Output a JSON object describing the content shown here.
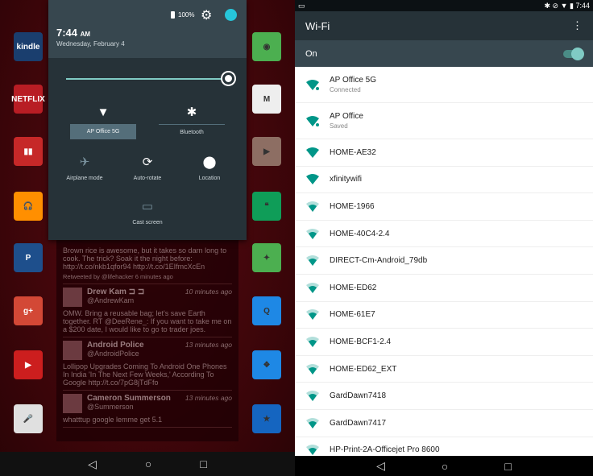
{
  "launcher": {
    "left_icons": [
      {
        "name": "kindle",
        "label": "kindle",
        "color": "#1a3e6e"
      },
      {
        "name": "netflix",
        "label": "NETFLIX",
        "color": "#b81d24"
      },
      {
        "name": "video",
        "label": "▮▮",
        "color": "#c62828"
      },
      {
        "name": "music",
        "label": "🎧",
        "color": "#ff8f00"
      },
      {
        "name": "pandora",
        "label": "P",
        "color": "#1e4f8c"
      },
      {
        "name": "google-plus",
        "label": "g+",
        "color": "#d34836"
      },
      {
        "name": "youtube",
        "label": "▶",
        "color": "#cc1e1e"
      },
      {
        "name": "voice",
        "label": "🎤",
        "color": "#e0e0e0"
      }
    ],
    "right_icons": [
      {
        "name": "chrome",
        "label": "◉",
        "color": "#4caf50"
      },
      {
        "name": "gmail",
        "label": "M",
        "color": "#eeeeee"
      },
      {
        "name": "play-store",
        "label": "▶",
        "color": "#8d6e63"
      },
      {
        "name": "hangouts",
        "label": "❝",
        "color": "#0f9d58"
      },
      {
        "name": "maps",
        "label": "✦",
        "color": "#4caf50"
      },
      {
        "name": "search",
        "label": "Q",
        "color": "#1e88e5"
      },
      {
        "name": "dropbox",
        "label": "❖",
        "color": "#1e88e5"
      },
      {
        "name": "app",
        "label": "★",
        "color": "#1565c0"
      }
    ]
  },
  "shade": {
    "battery": "100%",
    "time": "7:44",
    "ampm": "AM",
    "date": "Wednesday, February 4",
    "brightness": 1.0,
    "tiles": {
      "wifi": "AP Office 5G",
      "bluetooth": "Bluetooth",
      "airplane": "Airplane mode",
      "rotate": "Auto-rotate",
      "location": "Location",
      "cast": "Cast screen"
    }
  },
  "tweets": {
    "first_text": "Brown rice is awesome, but it takes so darn long to cook. The trick? Soak it the night before: http://t.co/nkb1qfor94 http://t.co/1EIfmcXcEn",
    "first_meta": "Retweeted by @lifehacker 6 minutes ago",
    "items": [
      {
        "name": "Drew Kam ⊐ ⊐",
        "handle": "@AndrewKam",
        "time": "10 minutes ago",
        "text": "OMW. Bring a reusable bag; let's save Earth together. RT @DeeRene_: If you want to take me on a $200 date, I would like to go to trader joes."
      },
      {
        "name": "Android Police",
        "handle": "@AndroidPolice",
        "time": "13 minutes ago",
        "text": "Lollipop Upgrades Coming To Android One Phones In India 'In The Next Few Weeks,' According To Google http://t.co/7pG8jTdFfo"
      },
      {
        "name": "Cameron Summerson",
        "handle": "@Summerson",
        "time": "13 minutes ago",
        "text": "whatttup google lemme get 5.1"
      }
    ]
  },
  "wifi": {
    "status_time": "7:44",
    "title": "Wi-Fi",
    "toggle_label": "On",
    "toggle_on": true,
    "accent": "#009688",
    "networks": [
      {
        "name": "AP Office 5G",
        "status": "Connected",
        "strength": 4
      },
      {
        "name": "AP Office",
        "status": "Saved",
        "strength": 4
      },
      {
        "name": "HOME-AE32",
        "strength": 4
      },
      {
        "name": "xfinitywifi",
        "strength": 4
      },
      {
        "name": "HOME-1966",
        "strength": 3
      },
      {
        "name": "HOME-40C4-2.4",
        "strength": 3
      },
      {
        "name": "DIRECT-Cm-Android_79db",
        "strength": 3
      },
      {
        "name": "HOME-ED62",
        "strength": 3
      },
      {
        "name": "HOME-61E7",
        "strength": 3
      },
      {
        "name": "HOME-BCF1-2.4",
        "strength": 3
      },
      {
        "name": "HOME-ED62_EXT",
        "strength": 3
      },
      {
        "name": "GardDawn7418",
        "strength": 3
      },
      {
        "name": "GardDawn7417",
        "strength": 3
      },
      {
        "name": "HP-Print-2A-Officejet Pro 8600",
        "strength": 3
      }
    ]
  },
  "nav": {
    "back": "◁",
    "home": "○",
    "recents": "□"
  }
}
